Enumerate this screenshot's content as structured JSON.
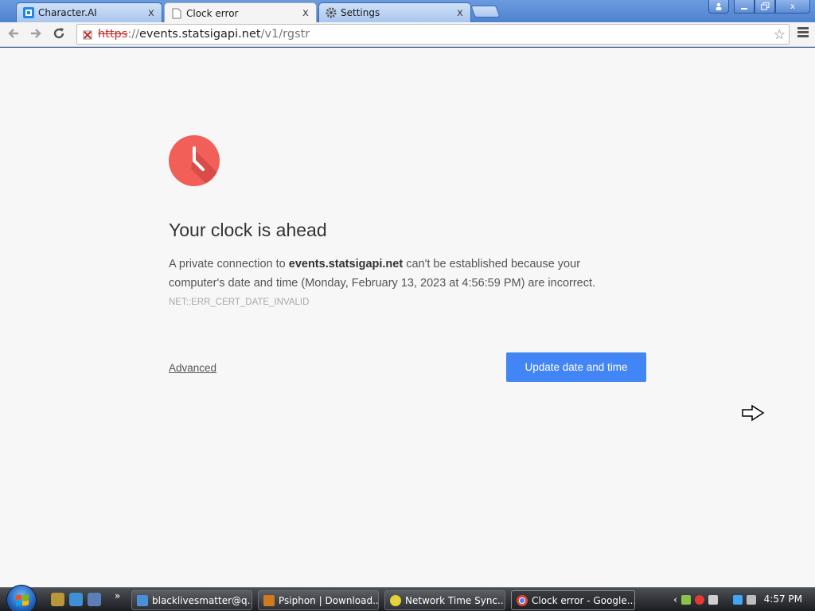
{
  "browser": {
    "tabs": [
      {
        "label": "Character.AI",
        "icon": "character-ai-icon",
        "active": false
      },
      {
        "label": "Clock error",
        "icon": "page-icon",
        "active": true
      },
      {
        "label": "Settings",
        "icon": "gear-icon",
        "active": false
      }
    ],
    "tab_close_glyph": "x",
    "window_close_glyph": "x",
    "url": {
      "scheme": "https",
      "separator": "://",
      "host": "events.statsigapi.net",
      "path": "/v1/rgstr"
    }
  },
  "page": {
    "headline": "Your clock is ahead",
    "message_part1": "A private connection to ",
    "message_host": "events.statsigapi.net",
    "message_part2": " can't be established because your computer's date and time (Monday, February 13, 2023 at 4:56:59 PM) are incorrect.",
    "error_code": "NET::ERR_CERT_DATE_INVALID",
    "advanced_link": "Advanced",
    "primary_button": "Update date and time",
    "accent_color": "#4285f4",
    "clock_color": "#f15f58"
  },
  "taskbar": {
    "chevron": "»",
    "tasks": [
      {
        "label": "blacklivesmatter@q...",
        "icon": "app-icon"
      },
      {
        "label": "Psiphon | Download...",
        "icon": "psiphon-icon"
      },
      {
        "label": "Network Time Sync...",
        "icon": "network-time-icon"
      },
      {
        "label": "Clock error - Google...",
        "icon": "chrome-icon"
      }
    ],
    "clock": "4:57 PM"
  }
}
